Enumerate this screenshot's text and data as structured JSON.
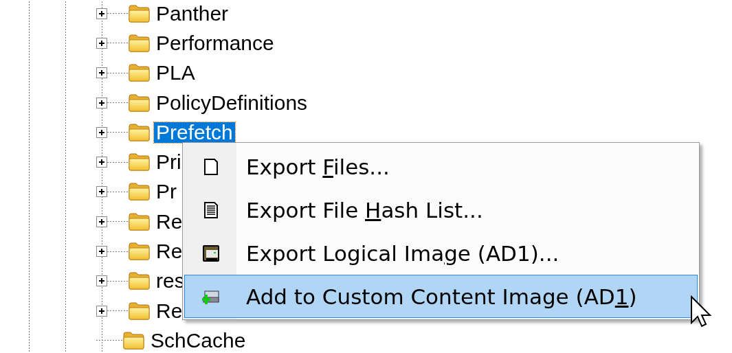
{
  "tree": {
    "items": [
      {
        "label": "Panther",
        "expanded": false,
        "selected": false
      },
      {
        "label": "Performance",
        "expanded": false,
        "selected": false
      },
      {
        "label": "PLA",
        "expanded": false,
        "selected": false
      },
      {
        "label": "PolicyDefinitions",
        "expanded": false,
        "selected": false
      },
      {
        "label": "Prefetch",
        "expanded": false,
        "selected": true
      },
      {
        "label": "Pri",
        "expanded": false,
        "selected": false
      },
      {
        "label": "Pr",
        "expanded": false,
        "selected": false
      },
      {
        "label": "Re",
        "expanded": false,
        "selected": false
      },
      {
        "label": "Re",
        "expanded": false,
        "selected": false
      },
      {
        "label": "res",
        "expanded": false,
        "selected": false
      },
      {
        "label": "Re",
        "expanded": false,
        "selected": false
      },
      {
        "label": "SchCache",
        "selected": false
      }
    ]
  },
  "context_menu": {
    "items": [
      {
        "kind": "page",
        "before": "Export ",
        "key": "F",
        "after": "iles...",
        "selected": false
      },
      {
        "kind": "list",
        "before": "Export File ",
        "key": "H",
        "after": "ash List...",
        "selected": false
      },
      {
        "kind": "drive",
        "before": "Export Logical Ima",
        "key": "g",
        "after": "e (AD1)...",
        "selected": false
      },
      {
        "kind": "add",
        "before": "Add to Custom Content Image (AD",
        "key": "1",
        "after": ")",
        "selected": true
      }
    ]
  }
}
